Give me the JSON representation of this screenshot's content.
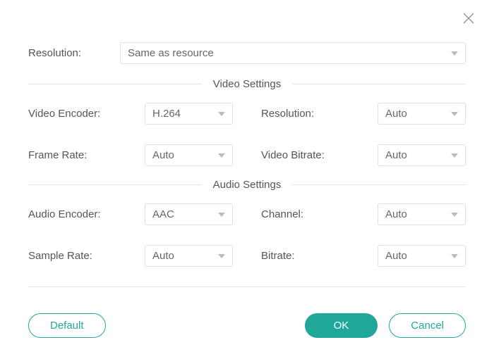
{
  "close_icon": "close",
  "top": {
    "resolution_label": "Resolution:",
    "resolution_value": "Same as resource"
  },
  "video": {
    "section_title": "Video Settings",
    "encoder_label": "Video Encoder:",
    "encoder_value": "H.264",
    "resolution_label": "Resolution:",
    "resolution_value": "Auto",
    "framerate_label": "Frame Rate:",
    "framerate_value": "Auto",
    "bitrate_label": "Video Bitrate:",
    "bitrate_value": "Auto"
  },
  "audio": {
    "section_title": "Audio Settings",
    "encoder_label": "Audio Encoder:",
    "encoder_value": "AAC",
    "channel_label": "Channel:",
    "channel_value": "Auto",
    "samplerate_label": "Sample Rate:",
    "samplerate_value": "Auto",
    "bitrate_label": "Bitrate:",
    "bitrate_value": "Auto"
  },
  "buttons": {
    "default": "Default",
    "ok": "OK",
    "cancel": "Cancel"
  },
  "colors": {
    "accent": "#1fa89a"
  }
}
